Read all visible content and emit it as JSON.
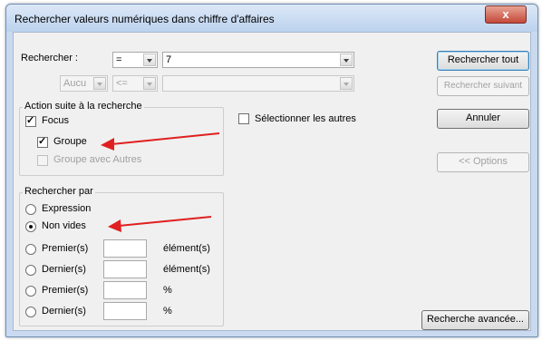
{
  "window": {
    "title": "Rechercher valeurs numériques dans chiffre d'affaires",
    "close_symbol": "x"
  },
  "search": {
    "label": "Rechercher :",
    "operator1": "=",
    "value1": "7",
    "conjunction": "Aucu",
    "operator2": "<=",
    "value2": ""
  },
  "buttons": {
    "find_all": "Rechercher tout",
    "find_next": "Rechercher suivant",
    "cancel": "Annuler",
    "options": "<< Options",
    "advanced": "Recherche avancée..."
  },
  "select_others": "Sélectionner les autres",
  "action_group": {
    "title": "Action suite à la recherche",
    "focus": "Focus",
    "group": "Groupe",
    "group_with_others": "Groupe avec Autres"
  },
  "search_by": {
    "title": "Rechercher par",
    "expression": "Expression",
    "non_empty": "Non vides",
    "first_n": "Premier(s)",
    "last_n": "Dernier(s)",
    "first_pct": "Premier(s)",
    "last_pct": "Dernier(s)",
    "unit_elements": "élément(s)",
    "unit_elements_2": "élément(s)",
    "unit_pct": "%",
    "unit_pct_2": "%"
  },
  "colors": {
    "annotation_arrow": "#e02020",
    "titlebar": "#c9daf0"
  }
}
